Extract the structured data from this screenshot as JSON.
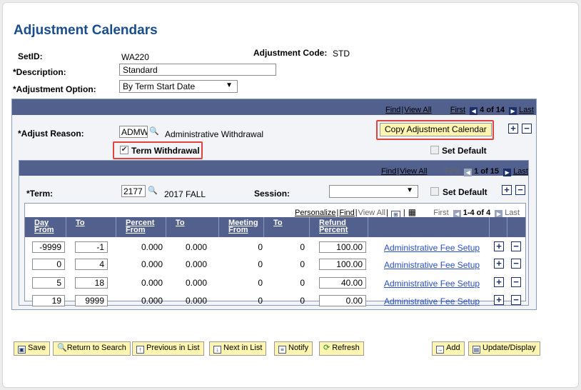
{
  "page_title": "Adjustment Calendars",
  "header": {
    "setid_label": "SetID:",
    "setid_value": "WA220",
    "adj_code_label": "Adjustment Code:",
    "adj_code_value": "STD",
    "description_label": "*Description:",
    "description_value": "Standard",
    "adj_option_label": "*Adjustment Option:",
    "adj_option_value": "By Term Start Date"
  },
  "outer_nav": {
    "find": "Find",
    "view_all": "View All",
    "first": "First",
    "position": "4 of 14",
    "last": "Last"
  },
  "reason": {
    "label": "*Adjust Reason:",
    "code": "ADMW",
    "description": "Administrative Withdrawal",
    "copy_button": "Copy Adjustment Calendar",
    "term_withdrawal_label": "Term Withdrawal",
    "term_withdrawal_checked": true,
    "set_default_label": "Set Default",
    "set_default_checked": false
  },
  "inner_nav": {
    "find": "Find",
    "view_all": "View All",
    "first": "First",
    "position": "1 of 15",
    "last": "Last"
  },
  "term": {
    "label": "*Term:",
    "code": "2177",
    "description": "2017 FALL",
    "session_label": "Session:",
    "session_value": "",
    "set_default_label": "Set Default",
    "set_default_checked": false
  },
  "grid_nav": {
    "personalize": "Personalize",
    "find": "Find",
    "view_all": "View All",
    "first": "First",
    "position": "1-4 of 4",
    "last": "Last"
  },
  "grid": {
    "columns": [
      {
        "l1": "Day",
        "l2": "From"
      },
      {
        "l1": "To",
        "l2": ""
      },
      {
        "l1": "Percent",
        "l2": "From"
      },
      {
        "l1": "To",
        "l2": ""
      },
      {
        "l1": "Meeting",
        "l2": "From"
      },
      {
        "l1": "To",
        "l2": ""
      },
      {
        "l1": "Refund",
        "l2": "Percent"
      }
    ],
    "rows": [
      {
        "day_from": "-9999",
        "day_to": "-1",
        "pct_from": "0.000",
        "pct_to": "0.000",
        "mtg_from": "0",
        "mtg_to": "0",
        "refund": "100.00",
        "link": "Administrative Fee Setup"
      },
      {
        "day_from": "0",
        "day_to": "4",
        "pct_from": "0.000",
        "pct_to": "0.000",
        "mtg_from": "0",
        "mtg_to": "0",
        "refund": "100.00",
        "link": "Administrative Fee Setup"
      },
      {
        "day_from": "5",
        "day_to": "18",
        "pct_from": "0.000",
        "pct_to": "0.000",
        "mtg_from": "0",
        "mtg_to": "0",
        "refund": "40.00",
        "link": "Administrative Fee Setup"
      },
      {
        "day_from": "19",
        "day_to": "9999",
        "pct_from": "0.000",
        "pct_to": "0.000",
        "mtg_from": "0",
        "mtg_to": "0",
        "refund": "0.00",
        "link": "Administrative Fee Setup"
      }
    ]
  },
  "toolbar": {
    "save": "Save",
    "return_to_search": "Return to Search",
    "previous_in_list": "Previous in List",
    "next_in_list": "Next in List",
    "notify": "Notify",
    "refresh": "Refresh",
    "add": "Add",
    "update_display": "Update/Display"
  },
  "colors": {
    "title": "#1a4d8c",
    "bar": "#52608e",
    "button": "#fdf5b0",
    "highlight": "#e0443e",
    "link": "#2a4fbf"
  }
}
